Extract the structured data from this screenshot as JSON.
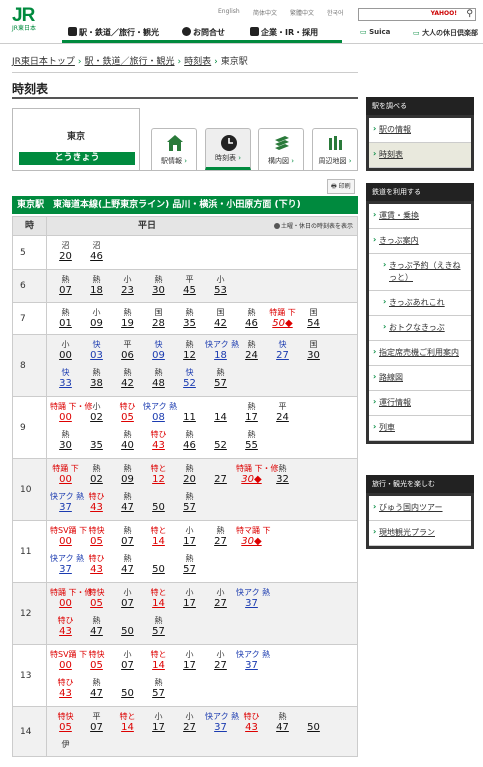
{
  "header": {
    "logo": "JR",
    "logo_sub": "JR東日本",
    "languages": [
      "English",
      "简体中文",
      "繁體中文",
      "한국어"
    ],
    "search_brand": "YAHOO!",
    "nav": [
      "駅・鉄道／旅行・観光",
      "お問合せ",
      "企業・IR・採用"
    ],
    "nav_right": [
      "Suica",
      "大人の休日倶楽部"
    ]
  },
  "breadcrumb": [
    "JR東日本トップ",
    "駅・鉄道／旅行・観光",
    "時刻表",
    "東京駅"
  ],
  "page_title": "時刻表",
  "station": {
    "name": "東京",
    "kana": "とうきょう"
  },
  "tabs": [
    "駅情報",
    "時刻表",
    "構内図",
    "周辺地図"
  ],
  "print_label": "印刷",
  "timetable": {
    "title": "東京駅　東海道本線(上野東京ライン) 品川・横浜・小田原方面 (下り)",
    "hour_header": "時",
    "day_header": "平日",
    "holiday_link": "土曜・休日の時刻表を表示",
    "rows": [
      {
        "hour": "5",
        "deps": [
          [
            "沼",
            "20",
            ""
          ],
          [
            "沼",
            "46",
            ""
          ]
        ]
      },
      {
        "hour": "6",
        "deps": [
          [
            "熱",
            "07",
            ""
          ],
          [
            "熱",
            "18",
            ""
          ],
          [
            "小",
            "23",
            ""
          ],
          [
            "熱",
            "30",
            ""
          ],
          [
            "平",
            "45",
            ""
          ],
          [
            "小",
            "53",
            ""
          ]
        ]
      },
      {
        "hour": "7",
        "deps": [
          [
            "熱",
            "01",
            ""
          ],
          [
            "小",
            "09",
            ""
          ],
          [
            "熱",
            "19",
            ""
          ],
          [
            "国",
            "28",
            ""
          ],
          [
            "熱",
            "35",
            ""
          ],
          [
            "国",
            "42",
            ""
          ],
          [
            "熱",
            "46",
            ""
          ],
          [
            "特踊 下",
            "50◆",
            "ri"
          ],
          [
            "国",
            "54",
            ""
          ]
        ]
      },
      {
        "hour": "8",
        "deps": [
          [
            "小",
            "00",
            ""
          ],
          [
            "快",
            "03",
            "b"
          ],
          [
            "平",
            "06",
            ""
          ],
          [
            "快",
            "09",
            "b"
          ],
          [
            "熱",
            "12",
            ""
          ],
          [
            "快アク 熱",
            "18",
            "b"
          ],
          [
            "熱",
            "24",
            ""
          ],
          [
            "快",
            "27",
            "b"
          ],
          [
            "国",
            "30",
            ""
          ],
          [
            "快",
            "33",
            "b"
          ],
          [
            "熱",
            "38",
            ""
          ],
          [
            "熱",
            "42",
            ""
          ],
          [
            "熱",
            "48",
            ""
          ],
          [
            "快",
            "52",
            "b"
          ],
          [
            "熱",
            "57",
            ""
          ]
        ]
      },
      {
        "hour": "9",
        "deps": [
          [
            "特踊 下・修",
            "00",
            "r"
          ],
          [
            "小",
            "02",
            ""
          ],
          [
            "特ひ",
            "05",
            "r"
          ],
          [
            "快アク 熱",
            "08",
            "b"
          ],
          [
            "",
            "11",
            ""
          ],
          [
            "",
            "14",
            ""
          ],
          [
            "熱",
            "17",
            ""
          ],
          [
            "平",
            "24",
            ""
          ],
          [
            "熱",
            "30",
            ""
          ],
          [
            "",
            "35",
            ""
          ],
          [
            "熱",
            "40",
            ""
          ],
          [
            "特ひ",
            "43",
            "r"
          ],
          [
            "熱",
            "46",
            ""
          ],
          [
            "",
            "52",
            ""
          ],
          [
            "熱",
            "55",
            ""
          ]
        ]
      },
      {
        "hour": "10",
        "deps": [
          [
            "特踊 下",
            "00",
            "r"
          ],
          [
            "熱",
            "02",
            ""
          ],
          [
            "熱",
            "09",
            ""
          ],
          [
            "特と",
            "12",
            "r"
          ],
          [
            "熱",
            "20",
            ""
          ],
          [
            "",
            "27",
            ""
          ],
          [
            "特踊 下・修",
            "30◆",
            "ri"
          ],
          [
            "熱",
            "32",
            ""
          ],
          [
            "快アク 熱",
            "37",
            "b"
          ],
          [
            "特ひ",
            "43",
            "r"
          ],
          [
            "熱",
            "47",
            ""
          ],
          [
            "",
            "50",
            ""
          ],
          [
            "熱",
            "57",
            ""
          ]
        ]
      },
      {
        "hour": "11",
        "deps": [
          [
            "特SV踊 下",
            "00",
            "r"
          ],
          [
            "特快",
            "05",
            "r"
          ],
          [
            "熱",
            "07",
            ""
          ],
          [
            "特と",
            "14",
            "r"
          ],
          [
            "小",
            "17",
            ""
          ],
          [
            "熱",
            "27",
            ""
          ],
          [
            "特マ踊 下",
            "30◆",
            "ri"
          ],
          [
            "快アク 熱",
            "37",
            "b"
          ],
          [
            "特ひ",
            "43",
            "r"
          ],
          [
            "熱",
            "47",
            ""
          ],
          [
            "",
            "50",
            ""
          ],
          [
            "熱",
            "57",
            ""
          ]
        ]
      },
      {
        "hour": "12",
        "deps": [
          [
            "特踊 下・修",
            "00",
            "r"
          ],
          [
            "特快",
            "05",
            "r"
          ],
          [
            "小",
            "07",
            ""
          ],
          [
            "特と",
            "14",
            "r"
          ],
          [
            "小",
            "17",
            ""
          ],
          [
            "小",
            "27",
            ""
          ],
          [
            "快アク 熱",
            "37",
            "b"
          ],
          [
            "特ひ",
            "43",
            "r"
          ],
          [
            "熱",
            "47",
            ""
          ],
          [
            "",
            "50",
            ""
          ],
          [
            "熱",
            "57",
            ""
          ]
        ]
      },
      {
        "hour": "13",
        "deps": [
          [
            "特SV踊 下",
            "00",
            "r"
          ],
          [
            "特快",
            "05",
            "r"
          ],
          [
            "小",
            "07",
            ""
          ],
          [
            "特と",
            "14",
            "r"
          ],
          [
            "小",
            "17",
            ""
          ],
          [
            "小",
            "27",
            ""
          ],
          [
            "快アク 熱",
            "37",
            "b"
          ],
          [
            "特ひ",
            "43",
            "r"
          ],
          [
            "熱",
            "47",
            ""
          ],
          [
            "",
            "50",
            ""
          ],
          [
            "熱",
            "57",
            ""
          ]
        ]
      },
      {
        "hour": "14",
        "deps": [
          [
            "特快",
            "05",
            "r"
          ],
          [
            "平",
            "07",
            ""
          ],
          [
            "特と",
            "14",
            "r"
          ],
          [
            "小",
            "17",
            ""
          ],
          [
            "小",
            "27",
            ""
          ],
          [
            "快アク 熱",
            "37",
            "b"
          ],
          [
            "特ひ",
            "43",
            "r"
          ],
          [
            "熱",
            "47",
            ""
          ],
          [
            "",
            "50",
            ""
          ],
          [
            "伊",
            "",
            ""
          ]
        ]
      }
    ]
  },
  "sidebar": {
    "station_title": "駅を調べる",
    "station_items": [
      "駅の情報",
      "時刻表"
    ],
    "rail_title": "鉄道を利用する",
    "rail_items": [
      "運賃・乗換",
      "きっぷ案内",
      "きっぷ予約（えきねっと）",
      "きっぷあれこれ",
      "おトクなきっぷ",
      "指定席売機ご利用案内",
      "路線図",
      "運行情報",
      "列車"
    ],
    "travel_title": "旅行・観光を楽しむ",
    "travel_items": [
      "びゅう国内ツアー",
      "現地観光プラン"
    ]
  },
  "colors": {
    "brand": "#008a3e",
    "limited": "#d00000",
    "rapid": "#1b3bb0"
  }
}
